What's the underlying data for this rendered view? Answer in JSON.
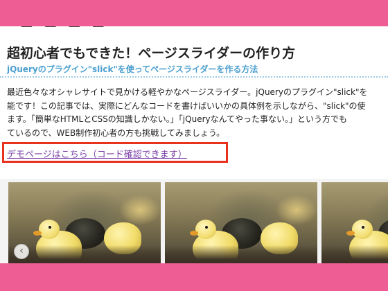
{
  "article": {
    "title": "超初心者でもできた！ページスライダーの作り方",
    "subtitle": "jQueryのプラグイン\"slick\"を使ってページスライダーを作る方法",
    "body_lines": [
      "最近色々なオシャレサイトで見かける軽やかなページスライダー。jQueryのプラグイン\"slick\"を",
      "能です！この記事では、実際にどんなコードを書けばいいかの具体例を示しながら、\"slick\"の使",
      "ます。「簡単なHTMLとCSSの知識しかない。」「jQueryなんてやった事ない。」という方でも",
      "ているので、WEB制作初心者の方も挑戦してみましょう。"
    ],
    "demo_link": "デモページはこちら（コード確認できます）"
  },
  "slider": {
    "prev_icon": "‹",
    "slide_count": 3
  },
  "colors": {
    "background": "#ee5e95",
    "accent_blue": "#4b9fcf",
    "highlight_red": "#e8321e",
    "link_purple": "#7a3fa8"
  }
}
